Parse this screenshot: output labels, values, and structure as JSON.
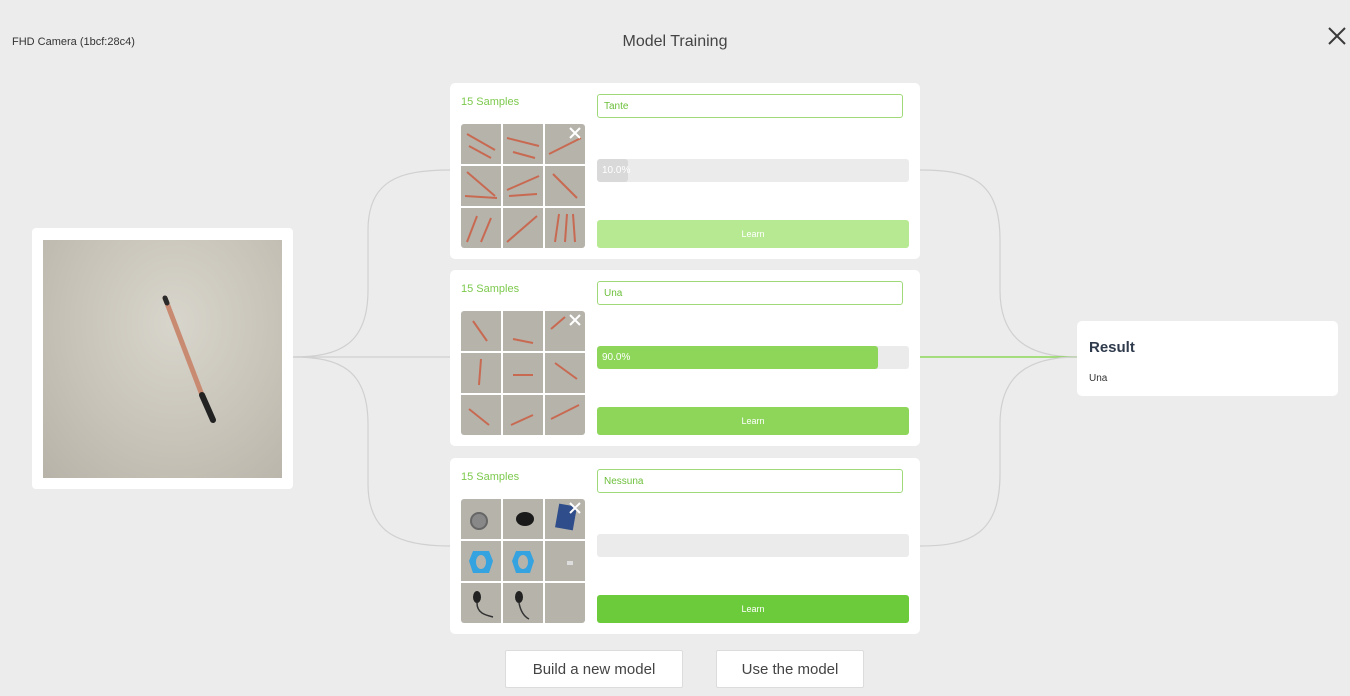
{
  "header": {
    "camera_name": "FHD Camera (1bcf:28c4)",
    "title": "Model Training"
  },
  "classes": [
    {
      "samples": "15 Samples",
      "name": "Tante",
      "progress_value": 0.1,
      "progress_text": "10.0%",
      "learn_label": "Learn",
      "learn_color": "#b7e993",
      "fill_color": "#d9d9d9"
    },
    {
      "samples": "15 Samples",
      "name": "Una",
      "progress_value": 0.9,
      "progress_text": "90.0%",
      "learn_label": "Learn",
      "learn_color": "#8dd65a",
      "fill_color": "#8dd65a"
    },
    {
      "samples": "15 Samples",
      "name": "Nessuna",
      "progress_value": 0.0,
      "progress_text": "",
      "learn_label": "Learn",
      "learn_color": "#6ccb3a",
      "fill_color": "#6ccb3a"
    }
  ],
  "result": {
    "title": "Result",
    "value": "Una"
  },
  "actions": {
    "build_label": "Build a new model",
    "use_label": "Use the model"
  },
  "colors": {
    "accent": "#8dd65a",
    "connector_active": "#8dd65a",
    "connector_idle": "#cfcfcf"
  },
  "icons": {
    "close": "close-icon",
    "remove_samples": "close-icon"
  }
}
